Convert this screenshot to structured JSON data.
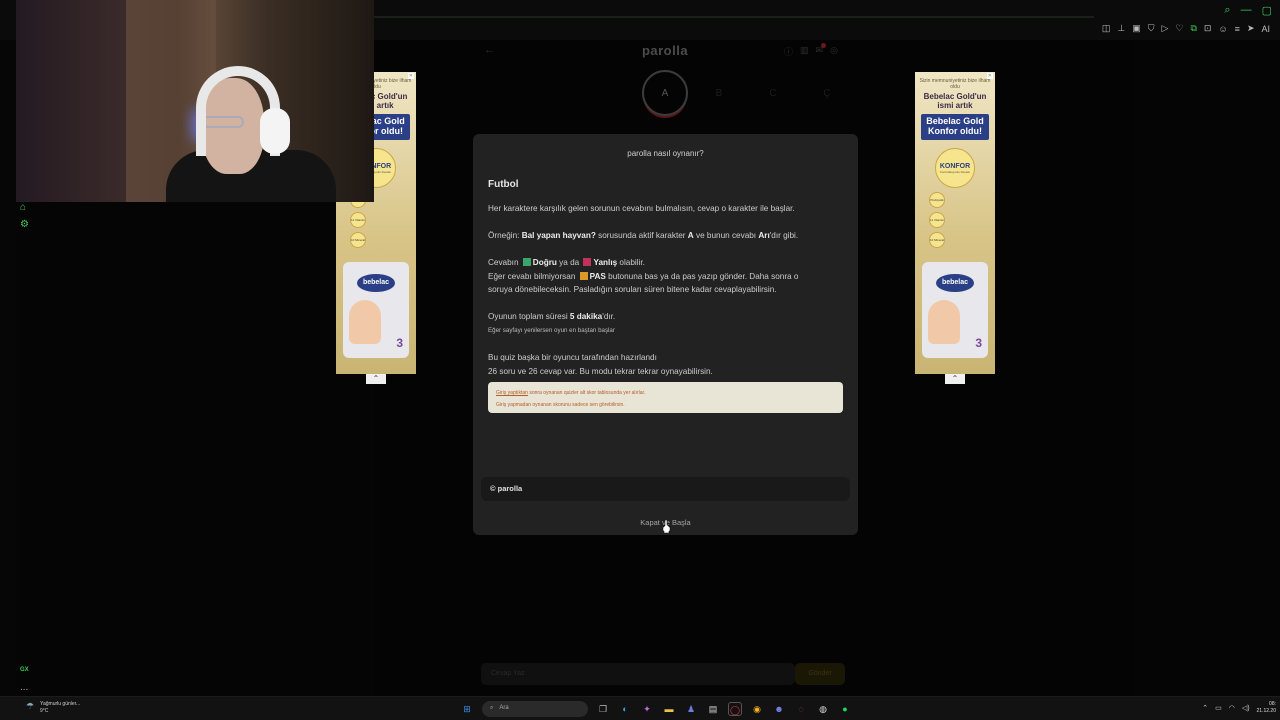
{
  "window": {
    "controls": [
      "⌕",
      "—",
      "▢"
    ]
  },
  "browser_toolbar": {
    "icons": [
      "panel-icon",
      "pin-icon",
      "capture-icon",
      "shield-icon",
      "play-icon",
      "heart-icon",
      "extensions-icon",
      "lock-icon",
      "profile-icon",
      "settings-icon",
      "send-icon"
    ],
    "ai_label": "AI"
  },
  "sidebar": {
    "icons": [
      "home-icon",
      "settings-icon"
    ],
    "bottom_label": "GX",
    "bottom_more": "..."
  },
  "site": {
    "logo": "parolla",
    "back": "←",
    "header_icons": [
      "info-icon",
      "stats-icon",
      "notification-icon",
      "user-icon"
    ]
  },
  "letters": [
    {
      "char": "A",
      "active": true
    },
    {
      "char": "B",
      "active": false
    },
    {
      "char": "C",
      "active": false
    },
    {
      "char": "Ç",
      "active": false
    }
  ],
  "ad_left": {
    "small": "Sizin memnuniyetiniz bize ilham oldu",
    "headline": "Bebelac Gold'un ismi artık",
    "banner": "Bebelac Gold Konfor oldu!",
    "konfor_title": "KONFOR",
    "konfor_sub": "Formülasyonlu Destek",
    "badges": [
      "Prebiyotik",
      "11 Vitamin",
      "10 Mineral"
    ],
    "brand": "bebelac",
    "number": "3"
  },
  "ad_right": {
    "small": "Sizin memnuniyetiniz bize ilham oldu",
    "headline": "Bebelac Gold'un ismi artık",
    "banner": "Bebelac Gold Konfor oldu!",
    "konfor_title": "KONFOR",
    "konfor_sub": "Formülasyonlu Destek",
    "badges": [
      "Prebiyotik",
      "11 Vitamin",
      "10 Mineral"
    ],
    "brand": "bebelac",
    "number": "3"
  },
  "modal": {
    "title": "parolla nasıl oynanır?",
    "heading": "Futbol",
    "p1": "Her karaktere karşılık gelen sorunun cevabını bulmalısın, cevap o karakter ile başlar.",
    "p2_prefix": "Örneğin: ",
    "p2_question": "Bal yapan hayvan?",
    "p2_mid": " sorusunda aktif karakter ",
    "p2_char": "A",
    "p2_mid2": " ve bunun cevabı ",
    "p2_answer": "Arı",
    "p2_suffix": "'dır gibi.",
    "p3_prefix": "Cevabın ",
    "p3_correct": "Doğru",
    "p3_mid": " ya da ",
    "p3_wrong": "Yanlış",
    "p3_suffix": " olabilir.",
    "p4_prefix": "Eğer cevabı bilmiyorsan ",
    "p4_pas": "PAS",
    "p4_suffix": " butonuna bas ya da pas yazıp gönder. Daha sonra o",
    "p5": "soruya dönebileceksin. Pasladığın soruları süren bitene kadar cevaplayabilirsin.",
    "p6_prefix": "Oyunun toplam süresi ",
    "p6_time": "5 dakika",
    "p6_suffix": "'dır.",
    "p7": "Eğer sayfayı yenilersen oyun en baştan başlar",
    "p8": "Bu quiz başka bir oyuncu tarafından hazırlandı",
    "p9": "26 soru ve 26 cevap var. Bu modu tekrar tekrar oynayabilirsin.",
    "note_link": "Giriş yaptıktan",
    "note1_suffix": " sonra oynanan quizler alt skor tablosunda yer alırlar.",
    "note2": "Giriş yapmadan oynanan skorunu sadece sen görebilirsin.",
    "footer": "© parolla",
    "close_button": "Kapat ve Başla"
  },
  "bottom": {
    "input_placeholder": "Cevap Yaz",
    "send_label": "Gönder"
  },
  "taskbar": {
    "weather_line1": "Yağmurlu günler...",
    "weather_line2": "9°C",
    "search_label": "Ara",
    "time": "08:",
    "date": "21.12.20",
    "colors": {
      "windows": "#3a8ee6",
      "opera": "#e2343c",
      "chrome": "#f2b01e",
      "spotify": "#1ed760"
    }
  }
}
